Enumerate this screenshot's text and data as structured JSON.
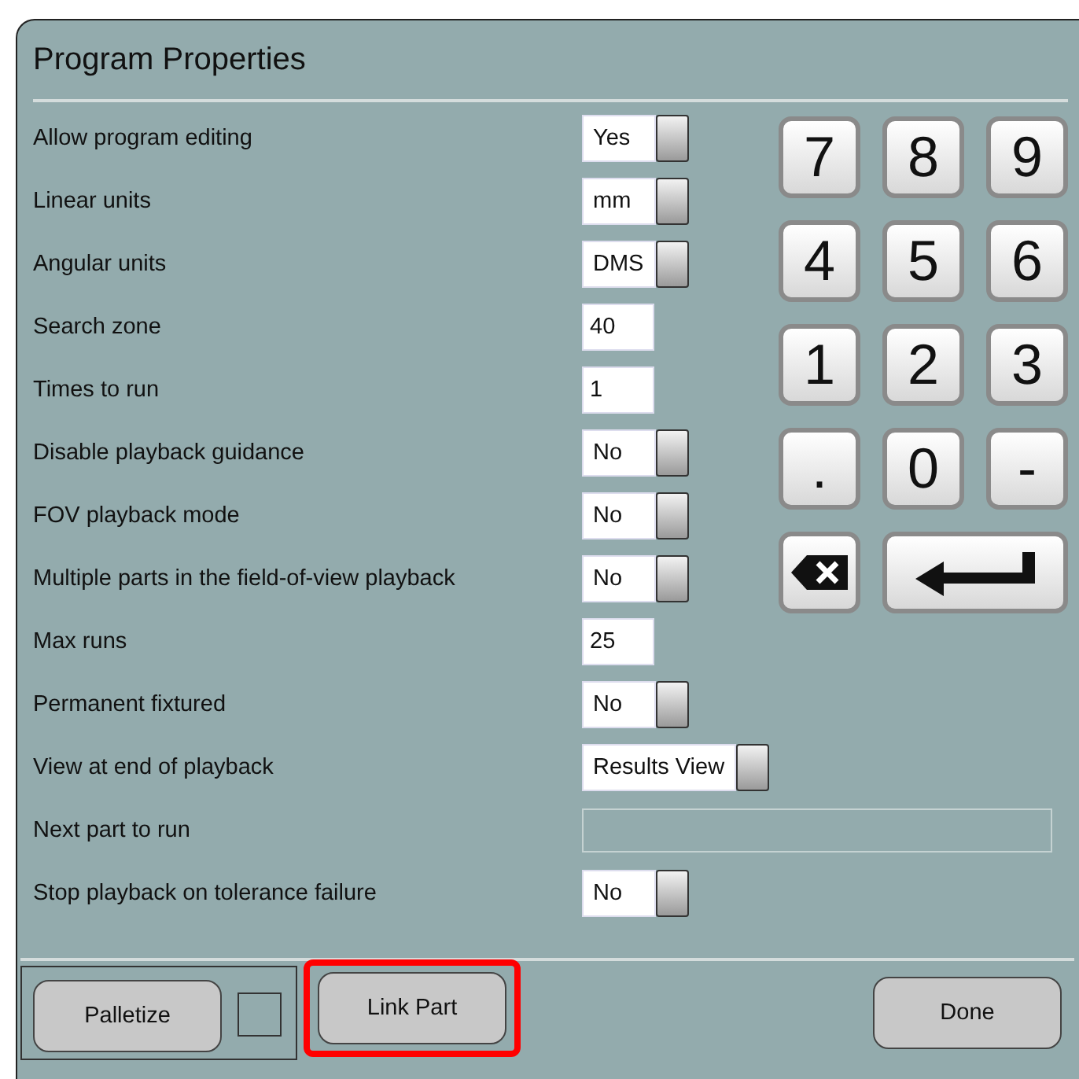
{
  "window": {
    "title": "Program Properties"
  },
  "properties": [
    {
      "label": "Allow program editing",
      "kind": "toggle",
      "value": "Yes"
    },
    {
      "label": "Linear units",
      "kind": "toggle",
      "value": "mm"
    },
    {
      "label": "Angular units",
      "kind": "toggle",
      "value": "DMS"
    },
    {
      "label": "Search zone",
      "kind": "input",
      "value": "40"
    },
    {
      "label": "Times to run",
      "kind": "input",
      "value": "1"
    },
    {
      "label": "Disable playback guidance",
      "kind": "toggle",
      "value": "No"
    },
    {
      "label": "FOV playback mode",
      "kind": "toggle",
      "value": "No"
    },
    {
      "label": "Multiple parts in the field-of-view playback",
      "kind": "toggle",
      "value": "No"
    },
    {
      "label": "Max runs",
      "kind": "input",
      "value": "25"
    },
    {
      "label": "Permanent fixtured",
      "kind": "toggle",
      "value": "No"
    },
    {
      "label": "View at end of playback",
      "kind": "toggle",
      "value": "Results View"
    },
    {
      "label": "Next part to run",
      "kind": "wide"
    },
    {
      "label": "Stop playback on tolerance failure",
      "kind": "toggle",
      "value": "No"
    }
  ],
  "keypad": [
    {
      "kind": "digit",
      "label": "7"
    },
    {
      "kind": "digit",
      "label": "8"
    },
    {
      "kind": "digit",
      "label": "9"
    },
    {
      "kind": "digit",
      "label": "4"
    },
    {
      "kind": "digit",
      "label": "5"
    },
    {
      "kind": "digit",
      "label": "6"
    },
    {
      "kind": "digit",
      "label": "1"
    },
    {
      "kind": "digit",
      "label": "2"
    },
    {
      "kind": "digit",
      "label": "3"
    },
    {
      "kind": "digit",
      "label": "."
    },
    {
      "kind": "digit",
      "label": "0"
    },
    {
      "kind": "digit",
      "label": "-"
    },
    {
      "kind": "backspace"
    },
    {
      "kind": "enter"
    }
  ],
  "footer": {
    "palletize": {
      "label": "Palletize",
      "checked": false
    },
    "buttons": [
      {
        "label": "Link Part",
        "highlighted": true
      },
      {
        "label": "Done",
        "highlighted": false
      }
    ]
  }
}
